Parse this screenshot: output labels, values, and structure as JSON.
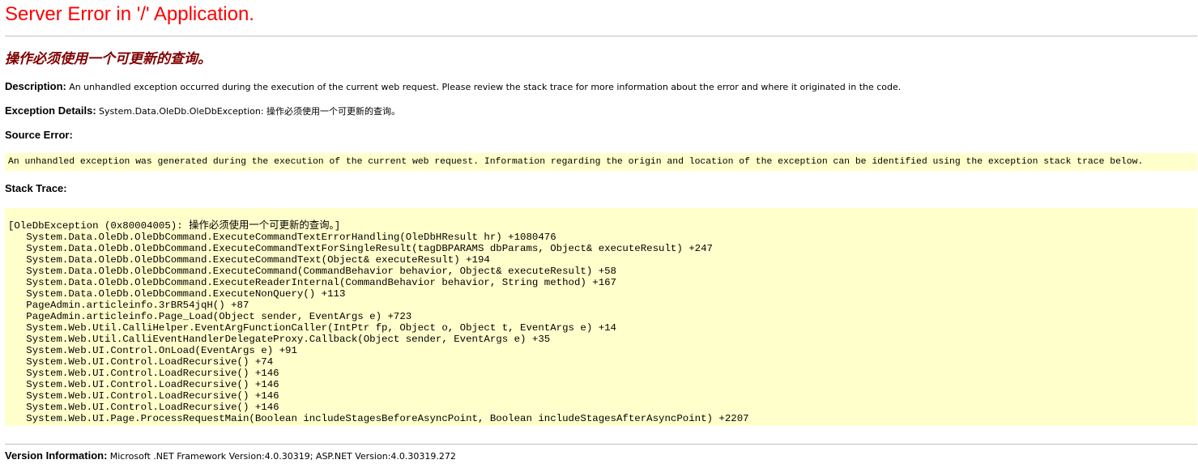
{
  "page_title": "Server Error in '/' Application.",
  "error_message": "操作必须使用一个可更新的查询。",
  "description": {
    "label": "Description:",
    "text": "An unhandled exception occurred during the execution of the current web request. Please review the stack trace for more information about the error and where it originated in the code."
  },
  "exception_details": {
    "label": "Exception Details:",
    "text": "System.Data.OleDb.OleDbException: 操作必须使用一个可更新的查询。"
  },
  "source_error": {
    "label": "Source Error:",
    "text": "An unhandled exception was generated during the execution of the current web request. Information regarding the origin and location of the exception can be identified using the exception stack trace below."
  },
  "stack_trace": {
    "label": "Stack Trace:",
    "text": "[OleDbException (0x80004005): 操作必须使用一个可更新的查询。]\n   System.Data.OleDb.OleDbCommand.ExecuteCommandTextErrorHandling(OleDbHResult hr) +1080476\n   System.Data.OleDb.OleDbCommand.ExecuteCommandTextForSingleResult(tagDBPARAMS dbParams, Object& executeResult) +247\n   System.Data.OleDb.OleDbCommand.ExecuteCommandText(Object& executeResult) +194\n   System.Data.OleDb.OleDbCommand.ExecuteCommand(CommandBehavior behavior, Object& executeResult) +58\n   System.Data.OleDb.OleDbCommand.ExecuteReaderInternal(CommandBehavior behavior, String method) +167\n   System.Data.OleDb.OleDbCommand.ExecuteNonQuery() +113\n   PageAdmin.articleinfo.3rBR54jqH() +87\n   PageAdmin.articleinfo.Page_Load(Object sender, EventArgs e) +723\n   System.Web.Util.CalliHelper.EventArgFunctionCaller(IntPtr fp, Object o, Object t, EventArgs e) +14\n   System.Web.Util.CalliEventHandlerDelegateProxy.Callback(Object sender, EventArgs e) +35\n   System.Web.UI.Control.OnLoad(EventArgs e) +91\n   System.Web.UI.Control.LoadRecursive() +74\n   System.Web.UI.Control.LoadRecursive() +146\n   System.Web.UI.Control.LoadRecursive() +146\n   System.Web.UI.Control.LoadRecursive() +146\n   System.Web.UI.Control.LoadRecursive() +146\n   System.Web.UI.Page.ProcessRequestMain(Boolean includeStagesBeforeAsyncPoint, Boolean includeStagesAfterAsyncPoint) +2207"
  },
  "version_information": {
    "label": "Version Information:",
    "text": "Microsoft .NET Framework Version:4.0.30319; ASP.NET Version:4.0.30319.272"
  },
  "colors": {
    "title": "#ff0000",
    "subtitle": "#800000",
    "code_background": "#ffffcc",
    "rule": "#c0c0c0"
  }
}
